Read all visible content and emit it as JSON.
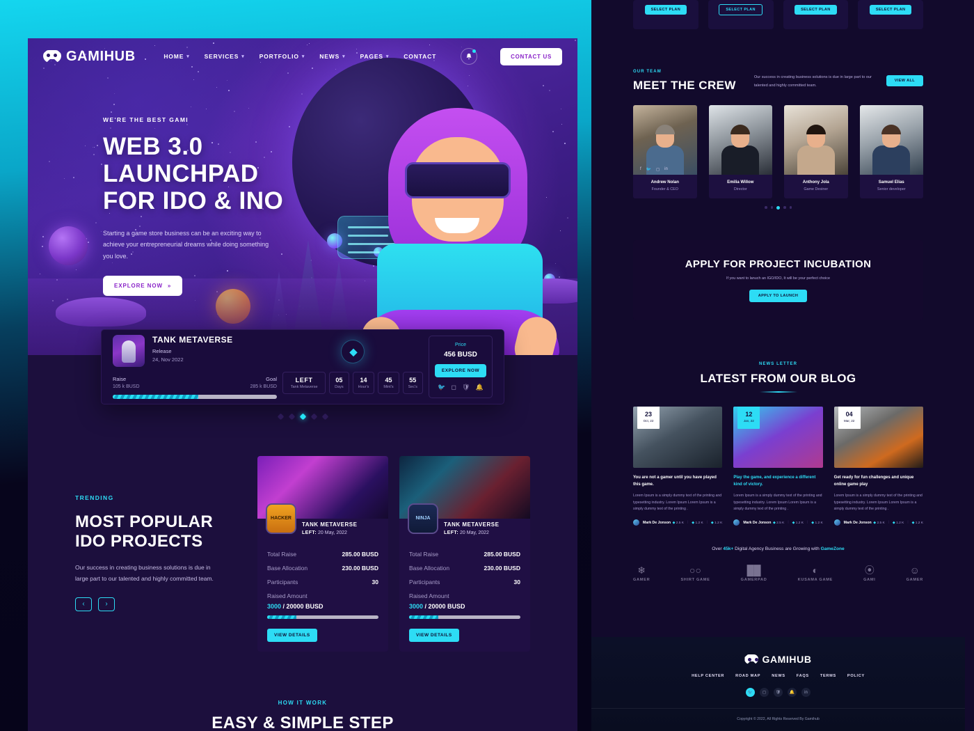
{
  "brand": {
    "name": "GAMIHUB",
    "accent": "#2ddcf5",
    "purple": "#8a23c9",
    "dark_bg": "#1c0f3d"
  },
  "header": {
    "nav": [
      {
        "label": "HOME",
        "caret": "▾"
      },
      {
        "label": "SERVICES",
        "caret": "▾"
      },
      {
        "label": "PORTFOLIO",
        "caret": "▾"
      },
      {
        "label": "NEWS",
        "caret": "▾"
      },
      {
        "label": "PAGES",
        "caret": "▾"
      },
      {
        "label": "CONTACT",
        "caret": ""
      }
    ],
    "bell_icon": "bell-icon",
    "cta_label": "CONTACT US"
  },
  "hero": {
    "eyebrow": "WE'RE THE BEST GAMI",
    "title_line1": "WEB 3.0",
    "title_line2": "LAUNCHPAD",
    "title_line3": "FOR IDO & INO",
    "paragraph": "Starting a game store business can be an exciting way to achieve your entrepreneurial dreams while doing something you love.",
    "button_label": "EXPLORE NOW",
    "button_icon": "double-chevron-right-icon"
  },
  "launchpad": {
    "thumb_name": "tank-metaverse-thumbnail",
    "title": "TANK METAVERSE",
    "release_label": "Release",
    "release_date": "24, Nov 2022",
    "raise_label": "Raise",
    "raise_value": "105 k BUSD",
    "goal_label": "Goal",
    "goal_value": "285 k BUSD",
    "progress_percent": 52,
    "emblem_icon": "diamond-emblem-icon",
    "countdown": [
      {
        "value": "LEFT",
        "unit": "Tank Metaverse",
        "wide": true
      },
      {
        "value": "05",
        "unit": "Days",
        "wide": false
      },
      {
        "value": "14",
        "unit": "Hour's",
        "wide": false
      },
      {
        "value": "45",
        "unit": "Mint's",
        "wide": false
      },
      {
        "value": "55",
        "unit": "Sec's",
        "wide": false
      }
    ],
    "price_label": "Price",
    "price_value": "456 BUSD",
    "price_button": "EXPLORE NOW",
    "socials": [
      "twitter-icon",
      "instagram-icon",
      "shield-icon",
      "bell-icon"
    ]
  },
  "hero_slider": {
    "total_dots": 5,
    "active_index": 2
  },
  "trending": {
    "eyebrow": "TRENDING",
    "title_line1": "MOST POPULAR",
    "title_line2": "IDO PROJECTS",
    "paragraph": "Our success in creating business solutions is due in large part to our talented and highly committed team.",
    "prev_icon": "chevron-left-icon",
    "next_icon": "chevron-right-icon",
    "cards": [
      {
        "badge_name": "hacker-badge-icon",
        "badge_text": "HACKER",
        "title": "TANK METAVERSE",
        "left_label": "LEFT:",
        "left_date": "20 May, 2022",
        "rows": [
          {
            "key": "Total Raise",
            "value": "285.00 BUSD"
          },
          {
            "key": "Base Allocation",
            "value": "230.00 BUSD"
          },
          {
            "key": "Participants",
            "value": "30"
          }
        ],
        "raised_label": "Raised Amount",
        "raised_current": "3000",
        "raised_total": "/ 20000 BUSD",
        "progress_percent": 26,
        "button_label": "VIEW DETAILS"
      },
      {
        "badge_name": "ninja-badge-icon",
        "badge_text": "NINJA",
        "title": "TANK METAVERSE",
        "left_label": "LEFT:",
        "left_date": "20 May, 2022",
        "rows": [
          {
            "key": "Total Raise",
            "value": "285.00 BUSD"
          },
          {
            "key": "Base Allocation",
            "value": "230.00 BUSD"
          },
          {
            "key": "Participants",
            "value": "30"
          }
        ],
        "raised_label": "Raised Amount",
        "raised_current": "3000",
        "raised_total": "/ 20000 BUSD",
        "progress_percent": 26,
        "button_label": "VIEW DETAILS"
      }
    ]
  },
  "how_it_work": {
    "eyebrow": "HOW IT WORK",
    "title": "EASY & SIMPLE STEP"
  },
  "pricing_strip": {
    "plans": [
      {
        "label": "SELECT PLAN",
        "ghost": false
      },
      {
        "label": "SELECT PLAN",
        "ghost": true
      },
      {
        "label": "SELECT PLAN",
        "ghost": false
      },
      {
        "label": "SELECT PLAN",
        "ghost": false
      }
    ]
  },
  "team": {
    "eyebrow": "OUR TEAM",
    "title": "MEET THE CREW",
    "description": "Our success in creating business solutions is due in large part to our talented and highly committed team.",
    "view_all_label": "VIEW ALL",
    "socials": [
      "facebook-icon",
      "twitter-icon",
      "instagram-icon",
      "linkedin-icon"
    ],
    "members": [
      {
        "name": "Andrew Nolan",
        "role": "Founder & CEO"
      },
      {
        "name": "Emilia Willow",
        "role": "Director"
      },
      {
        "name": "Anthony Jola",
        "role": "Game Desiner"
      },
      {
        "name": "Samuel Elias",
        "role": "Senior developer"
      }
    ],
    "dots": {
      "total": 5,
      "active_index": 2
    }
  },
  "incubation": {
    "title": "APPLY FOR PROJECT INCUBATION",
    "subtitle": "If you want to lanuch an IGO/IDO, It will be your perfect choice",
    "button_label": "APPLY TO LAUNCH"
  },
  "blog": {
    "eyebrow": "NEWS LETTER",
    "title": "LATEST FROM OUR BLOG",
    "posts": [
      {
        "day": "23",
        "month": "Oct, 22",
        "date_accent": false,
        "title": "You are not a gamer until you have played this game.",
        "title_accent": false,
        "excerpt": "Lorem Ipsum is  a simply dummy text of the printing and typesetting industry. Lorem Ipsum Lorem Ipsum is  a simply dummy text of the printing .",
        "author": "Mark De Jonson",
        "stats": [
          {
            "icon": "fire-icon",
            "value": "2.5 K"
          },
          {
            "icon": "comment-icon",
            "value": "1.2 K"
          },
          {
            "icon": "eye-icon",
            "value": "1.2 K"
          }
        ]
      },
      {
        "day": "12",
        "month": "Jan, 22",
        "date_accent": true,
        "title": "Play the game, and experience a different kind of victory.",
        "title_accent": true,
        "excerpt": "Lorem Ipsum is  a simply dummy text of the printing and typesetting industry. Lorem Ipsum Lorem Ipsum is  a simply dummy text of the printing .",
        "author": "Mark De Jonson",
        "stats": [
          {
            "icon": "fire-icon",
            "value": "2.5 K"
          },
          {
            "icon": "comment-icon",
            "value": "1.2 K"
          },
          {
            "icon": "eye-icon",
            "value": "1.2 K"
          }
        ]
      },
      {
        "day": "04",
        "month": "Mar, 22",
        "date_accent": false,
        "title": "Get ready for fun challenges and unique online game play",
        "title_accent": false,
        "excerpt": "Lorem Ipsum is  a simply dummy text of the printing and typesetting industry. Lorem Ipsum Lorem Ipsum is  a simply dummy text of the printing .",
        "author": "Mark De Jonson",
        "stats": [
          {
            "icon": "fire-icon",
            "value": "2.5 K"
          },
          {
            "icon": "comment-icon",
            "value": "1.2 K"
          },
          {
            "icon": "eye-icon",
            "value": "1.2 K"
          }
        ]
      }
    ]
  },
  "brands": {
    "line_pre": "Over ",
    "line_count": "45k+",
    "line_mid": " Digital Agency Business are Growing with ",
    "line_accent": "GameZone",
    "logos": [
      {
        "icon": "wings-gamepad-icon",
        "label": "GAMER"
      },
      {
        "icon": "two-circles-icon",
        "label": "SHIRT GAME"
      },
      {
        "icon": "stripes-pad-icon",
        "label": "GAMERPAD"
      },
      {
        "icon": "headset-cat-icon",
        "label": "KUSAMA GAME"
      },
      {
        "icon": "swirl-icon",
        "label": "GAMI"
      },
      {
        "icon": "gamer-face-icon",
        "label": "GAMER"
      }
    ]
  },
  "footer": {
    "logo": "GAMIHUB",
    "nav": [
      "HELP CENTER",
      "ROAD MAP",
      "NEWS",
      "FAQS",
      "TERMS",
      "POLICY"
    ],
    "socials": [
      "twitter-icon",
      "instagram-icon",
      "shield-icon",
      "bell-icon",
      "linkedin-icon"
    ],
    "copyright": "Copyright © 2022, All Rights Reserved By Gamihub"
  }
}
